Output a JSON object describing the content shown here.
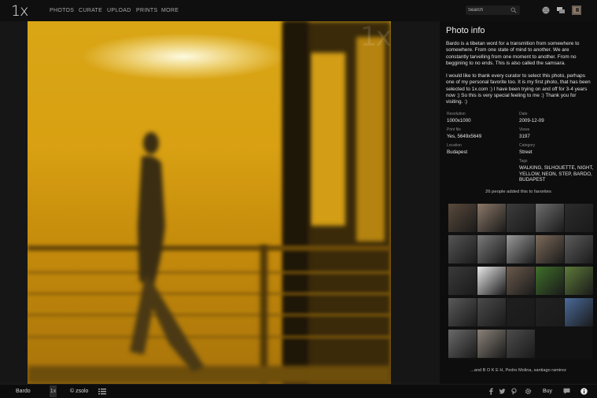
{
  "brand": {
    "logo": "1x"
  },
  "nav": {
    "items": [
      "PHOTOS",
      "CURATE",
      "UPLOAD",
      "PRINTS",
      "MORE"
    ]
  },
  "search": {
    "placeholder": "Search"
  },
  "photo": {
    "watermark": "1x"
  },
  "info": {
    "title": "Photo info",
    "description": [
      "Bardo is a tibetan word for a transmition from somewhere to somewhere. From one state of mind to another. We are constantly tarvelling from one moment to another. From no beggining to no ends. This is also called the samsara.",
      "I would like to thank every curator to select this photo, perhaps one of my personal favorite too. It is my first photo, that has been selected to 1x.com :) I have been trying on and off for 3-4 years now :) So this is very special feeling to me :) Thank you for visiting. :)"
    ],
    "meta": {
      "resolution_label": "Resolution",
      "resolution": "1000x1000",
      "date_label": "Date",
      "date": "2009-12-09",
      "print_label": "Print file",
      "print": "Yes, 5649x5649",
      "views_label": "Views",
      "views": "3197",
      "location_label": "Location",
      "location": "Budapest",
      "category_label": "Category",
      "category": "Street",
      "tags_label": "Tags",
      "tags": "WALKING, SILHOUETTE, NIGHT, YELLOW, NEON, STEP, BARDO, BUDAPEST"
    },
    "favorites_text": "26 people added this to favorites",
    "more_text": "...and B O K E H, Pedro Molina, santiago ramirez"
  },
  "bottom": {
    "title": "Bardo",
    "logo": "1x",
    "author": "© zsolo",
    "buy": "Buy"
  },
  "colors": {
    "accent_heart": "#e0233b",
    "panel_bg": "#0d0d0d",
    "photo_yellow": "#d9a616"
  }
}
